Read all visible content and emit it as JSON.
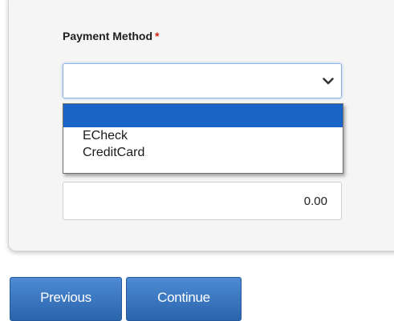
{
  "payment_method": {
    "label": "Payment Method",
    "required_mark": "*",
    "selected_value": "",
    "options": [
      "",
      "ECheck",
      "CreditCard"
    ]
  },
  "amount": {
    "value": "0.00"
  },
  "buttons": {
    "previous_label": "Previous",
    "continue_label": "Continue"
  },
  "icons": {
    "dropdown": "chevron-down-icon"
  },
  "colors": {
    "accent": "#1a64c8",
    "button": "#3a76c0",
    "required": "#d9261c"
  }
}
